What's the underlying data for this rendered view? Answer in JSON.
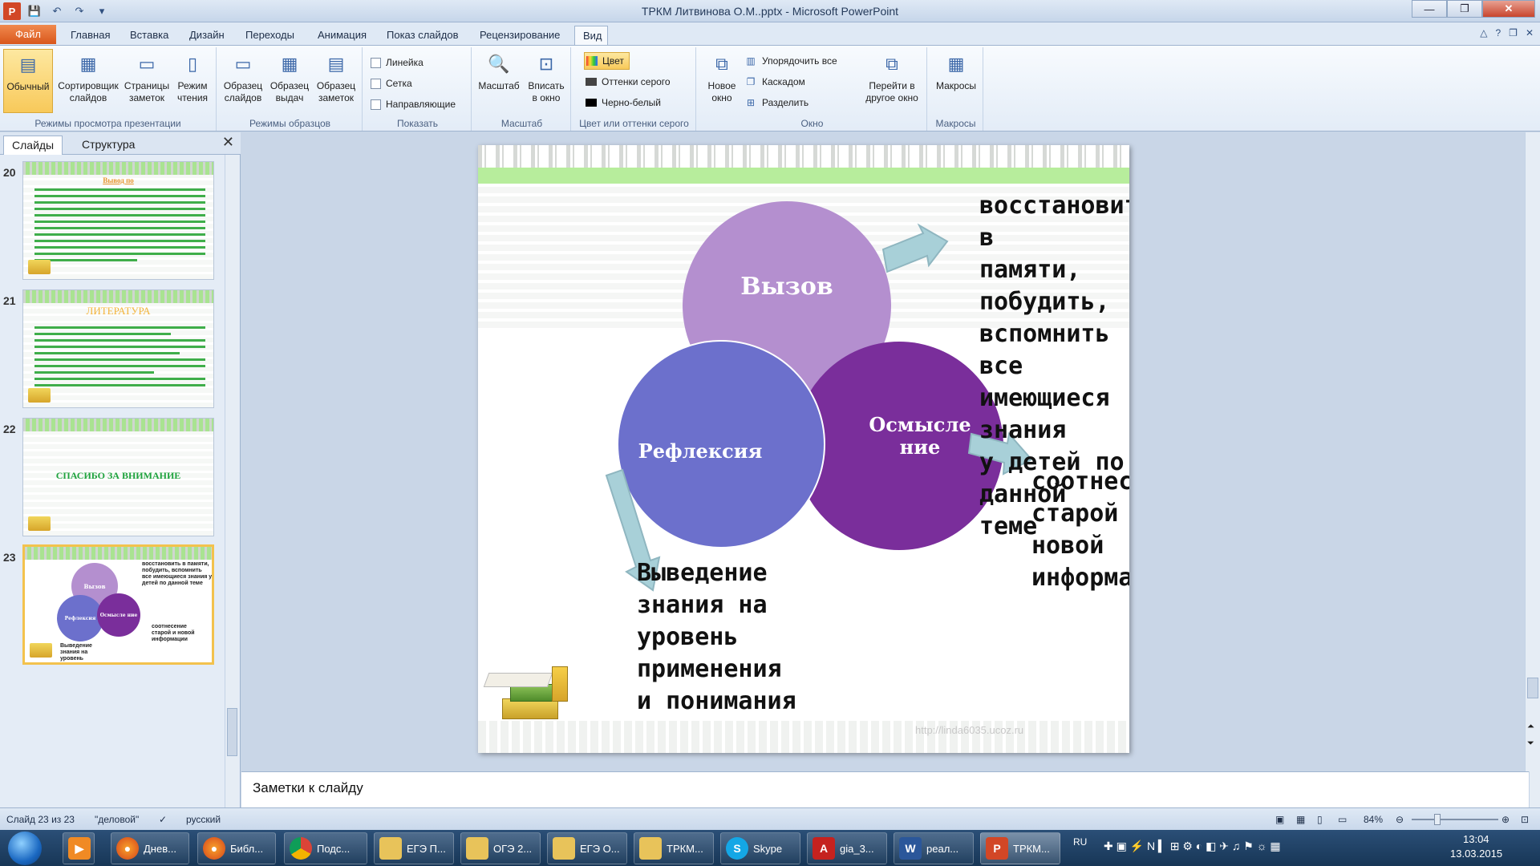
{
  "window": {
    "title": "ТРКМ Литвинова О.М..pptx - Microsoft PowerPoint",
    "min": "—",
    "max": "❐",
    "close": "✕"
  },
  "tabs": [
    {
      "label": "Файл"
    },
    {
      "label": "Главная"
    },
    {
      "label": "Вставка"
    },
    {
      "label": "Дизайн"
    },
    {
      "label": "Переходы"
    },
    {
      "label": "Анимация"
    },
    {
      "label": "Показ слайдов"
    },
    {
      "label": "Рецензирование"
    },
    {
      "label": "Вид"
    }
  ],
  "ribbon": {
    "views": {
      "label": "Режимы просмотра презентации",
      "normal": "Обычный",
      "sorter1": "Сортировщик",
      "sorter2": "слайдов",
      "notes1": "Страницы",
      "notes2": "заметок",
      "reading1": "Режим",
      "reading2": "чтения"
    },
    "masters": {
      "label": "Режимы образцов",
      "slide1": "Образец",
      "slide2": "слайдов",
      "handout1": "Образец",
      "handout2": "выдач",
      "notes1": "Образец",
      "notes2": "заметок"
    },
    "show": {
      "label": "Показать",
      "ruler": "Линейка",
      "grid": "Сетка",
      "guides": "Направляющие"
    },
    "zoom": {
      "label": "Масштаб",
      "zoom": "Масштаб",
      "fit1": "Вписать",
      "fit2": "в окно"
    },
    "color": {
      "label": "Цвет или оттенки серого",
      "color": "Цвет",
      "gray": "Оттенки серого",
      "bw": "Черно-белый"
    },
    "window": {
      "label": "Окно",
      "new1": "Новое",
      "new2": "окно",
      "arrange": "Упорядочить все",
      "cascade": "Каскадом",
      "split": "Разделить",
      "switch1": "Перейти в",
      "switch2": "другое окно"
    },
    "macros": {
      "label": "Макросы",
      "macros": "Макросы"
    }
  },
  "leftpane": {
    "tab_slides": "Слайды",
    "tab_outline": "Структура",
    "close": "✕",
    "thumbs": [
      {
        "num": "20",
        "title": "Вывод по"
      },
      {
        "num": "21",
        "title": "ЛИТЕРАТУРА"
      },
      {
        "num": "22",
        "title": "СПАСИБО ЗА ВНИМАНИЕ"
      },
      {
        "num": "23",
        "c1": "Вызов",
        "c2": "Рефлексия",
        "c3": "Осмысле ние",
        "t1": "восстановить в памяти, побудить, вспомнить все имеющиеся знания у детей по данной теме",
        "t2": "соотнесение старой и новой информации",
        "t3": "Выведение знания на уровень применения и понимания"
      }
    ]
  },
  "slide": {
    "circle_top": "Вызов",
    "circle_left": "Рефлексия",
    "circle_right_1": "Осмысле",
    "circle_right_2": "ние",
    "text_top": [
      "восстановить в",
      "памяти, побудить,",
      "вспомнить все",
      "имеющиеся знания",
      "у детей по данной",
      "теме"
    ],
    "text_right": [
      "соотнесение",
      "старой и",
      "новой",
      "информации"
    ],
    "text_bottom": [
      "Выведение",
      "знания на",
      "уровень",
      "применения",
      "и понимания"
    ],
    "watermark": "http://linda6035.ucoz.ru",
    "colors": {
      "top": "#b48fcf",
      "left": "#6c70cc",
      "right": "#7a2e9b",
      "arrow": "#a8d0d8"
    }
  },
  "notes": {
    "placeholder": "Заметки к слайду"
  },
  "status": {
    "slide": "Слайд 23 из 23",
    "theme": "\"деловой\"",
    "lang": "русский",
    "zoom": "84%"
  },
  "taskbar": {
    "items": [
      {
        "label": "Днев..."
      },
      {
        "label": "Библ..."
      },
      {
        "label": "Подс..."
      },
      {
        "label": "ЕГЭ П..."
      },
      {
        "label": "ОГЭ 2..."
      },
      {
        "label": "ЕГЭ О..."
      },
      {
        "label": "ТРКМ..."
      },
      {
        "label": "Skype"
      },
      {
        "label": "gia_3..."
      },
      {
        "label": "реал..."
      },
      {
        "label": "ТРКМ..."
      }
    ],
    "lang": "RU",
    "time": "13:04",
    "date": "13.03.2015"
  }
}
